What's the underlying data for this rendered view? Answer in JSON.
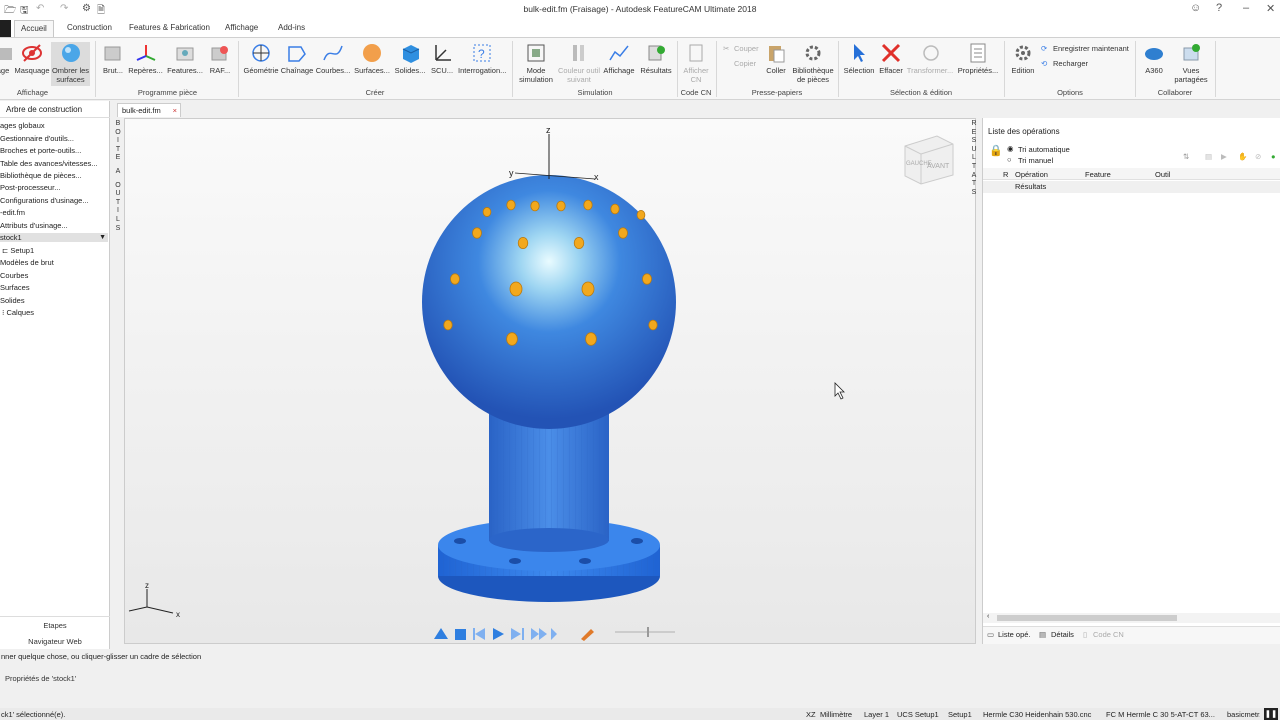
{
  "titlebar": {
    "title": "bulk-edit.fm (Fraisage) - Autodesk FeatureCAM Ultimate 2018"
  },
  "ribbon_tabs": [
    {
      "label": "Accueil",
      "active": true
    },
    {
      "label": "Construction"
    },
    {
      "label": "Features & Fabrication"
    },
    {
      "label": "Affichage"
    },
    {
      "label": "Add-ins"
    }
  ],
  "ribbon": {
    "buttons": {
      "hide": "age",
      "masquage": "Masquage",
      "ombrer": "Ombrer les surfaces",
      "brut": "Brut...",
      "reperes": "Repères...",
      "features": "Features...",
      "raf": "RAF...",
      "geometrie": "Géométrie",
      "chainage": "Chaînage",
      "courbes": "Courbes...",
      "surfaces": "Surfaces...",
      "solides": "Solides...",
      "scu": "SCU...",
      "interrogation": "Interrogation...",
      "mode_sim": "Mode simulation",
      "couleur": "Couleur outil suivant",
      "affichage": "Affichage",
      "resultats": "Résultats",
      "afficher_cn": "Afficher CN",
      "couper": "Couper",
      "copier": "Copier",
      "coller": "Coller",
      "bibliotheque": "Bibliothèque de pièces",
      "selection": "Sélection",
      "effacer": "Effacer",
      "transformer": "Transformer...",
      "proprietes": "Propriétés...",
      "edition": "Edition",
      "enregistrer": "Enregistrer maintenant",
      "recharger": "Recharger",
      "a360": "A360",
      "vues": "Vues partagées"
    },
    "groups": {
      "affichage": "Affichage",
      "programme": "Programme pièce",
      "creer": "Créer",
      "simulation": "Simulation",
      "codecn": "Code CN",
      "presse": "Presse-papiers",
      "selection": "Sélection & édition",
      "options": "Options",
      "collaborer": "Collaborer"
    }
  },
  "left_panel": {
    "header": "Arbre de construction",
    "items": [
      "ages globaux",
      "Gestionnaire d'outils...",
      "Broches et porte-outils...",
      "Table des avances/vitesses...",
      "Bibliothèque de pièces...",
      "Post-processeur...",
      "Configurations d'usinage...",
      "-edit.fm",
      "Attributs d'usinage...",
      "stock1",
      "Setup1",
      "Modèles de brut",
      "Courbes",
      "Surfaces",
      "Solides",
      "Calques"
    ],
    "bottom_tabs": [
      "Etapes",
      "Navigateur Web"
    ]
  },
  "vertical_strip_left": "BOITE A OUTILS",
  "vertical_strip_right": "RESULTATS",
  "document_tab": "bulk-edit.fm",
  "viewport": {
    "axis_z": "z",
    "axis_y": "y",
    "axis_x": "x",
    "viewcube_left": "GAUCHE",
    "viewcube_front": "AVANT"
  },
  "right_panel": {
    "title": "Liste des opérations",
    "sort_auto": "Tri automatique",
    "sort_manual": "Tri manuel",
    "col_r": "R",
    "col_operation": "Opération",
    "col_feature": "Feature",
    "col_outil": "Outil",
    "row_results": "Résultats",
    "bottom_tabs": [
      "Liste opé.",
      "Détails",
      "Code CN"
    ]
  },
  "message_line": "nner quelque chose, ou cliquer-glisser un cadre de sélection",
  "properties_line": "Propriétés de 'stock1'",
  "statusbar": {
    "left": "ck1' sélectionné(e).",
    "plane": "XZ",
    "units": "Millimètre",
    "layer": "Layer 1",
    "ucs": "UCS Setup1",
    "setup": "Setup1",
    "machine": "Hermle C30 Heidenhain 530.cnc",
    "fc": "FC M Hermle C 30 5-AT-CT 63...",
    "basic": "basicmetr..."
  },
  "colors": {
    "part_blue": "#3a7ee6",
    "hole_orange": "#f2a81d",
    "select_red": "#e0302a"
  }
}
